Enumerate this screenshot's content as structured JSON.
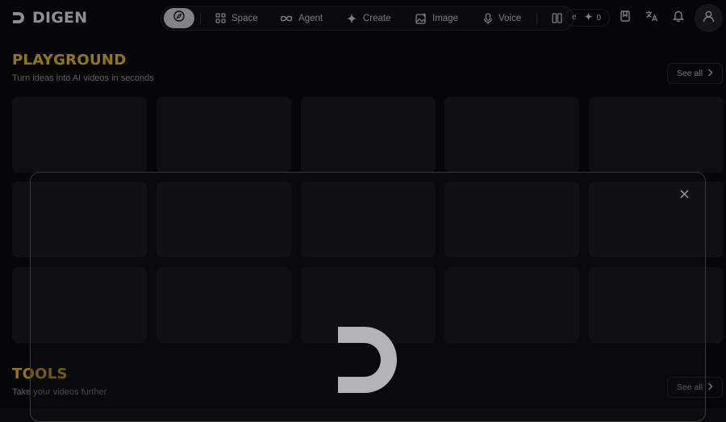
{
  "brand": {
    "name": "DIGEN",
    "logo_icon": "digen-d-logo-icon"
  },
  "nav": {
    "home_icon": "compass-icon",
    "items": [
      {
        "label": "Space",
        "icon": "grid-icon"
      },
      {
        "label": "Agent",
        "icon": "infinity-icon"
      },
      {
        "label": "Create",
        "icon": "sparkle-icon"
      },
      {
        "label": "Image",
        "icon": "image-icon"
      },
      {
        "label": "Voice",
        "icon": "microphone-icon"
      }
    ],
    "split_icon": "columns-icon"
  },
  "header": {
    "credit_partial_label": "e",
    "credits": "0",
    "icons": [
      "bookmark-icon",
      "translate-icon",
      "bell-icon",
      "user-icon"
    ]
  },
  "playground": {
    "title": "PLAYGROUND",
    "subtitle": "Turn ideas into AI videos in seconds",
    "see_all": "See all"
  },
  "tools": {
    "title": "TOOLS",
    "subtitle": "Take your videos further",
    "see_all": "See all"
  },
  "colors": {
    "accent": "#f0c419",
    "background": "#0b0b0d",
    "card": "#1a1a1e"
  }
}
